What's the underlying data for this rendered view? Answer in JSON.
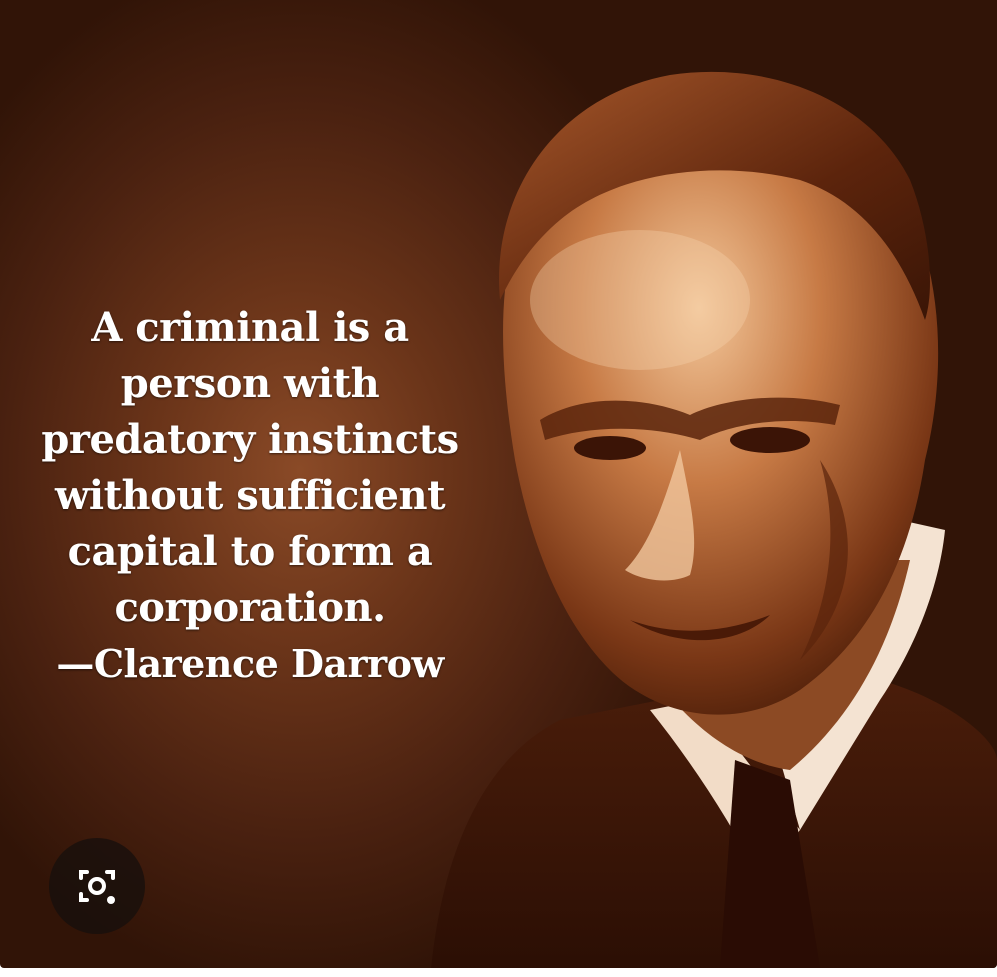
{
  "quote": {
    "lines": [
      "A criminal is a",
      "person with",
      "predatory instincts",
      "without sufficient",
      "capital to form a",
      "corporation."
    ],
    "attribution": "—Clarence Darrow"
  },
  "lens_button": {
    "icon": "camera-search-icon"
  },
  "colors": {
    "background_center": "#8a4a27",
    "background_edge": "#311407",
    "text": "#ffffff"
  }
}
